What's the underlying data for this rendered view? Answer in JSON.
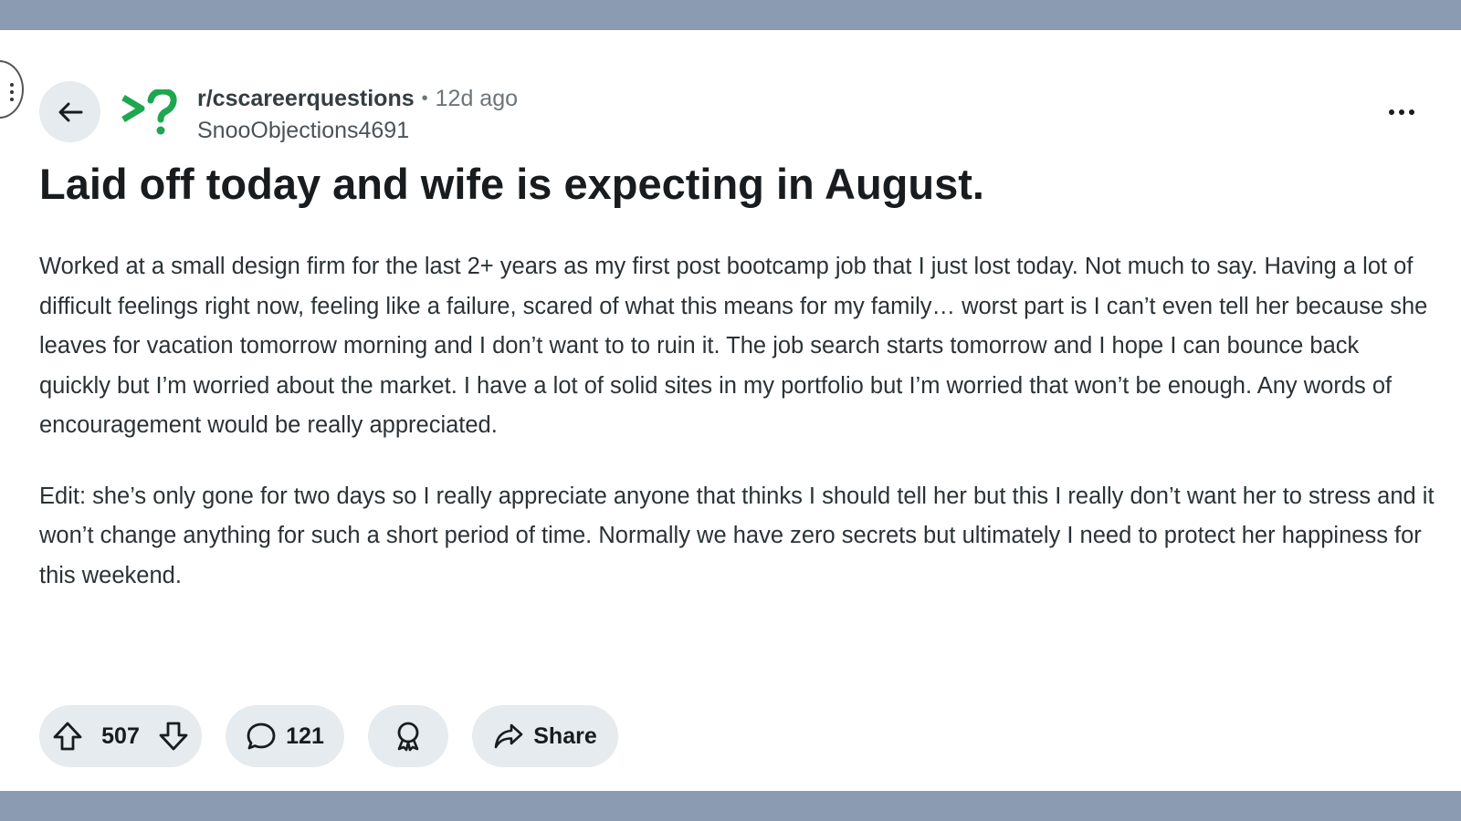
{
  "post": {
    "subreddit": "r/cscareerquestions",
    "separator": "•",
    "age": "12d ago",
    "author": "SnooObjections4691",
    "title": "Laid off today and wife is expecting in August.",
    "paragraphs": [
      "Worked at a small design firm for the last 2+ years as my first post bootcamp job that I just lost today. Not much to say. Having a lot of difficult feelings right now, feeling like a failure, scared of what this means for my family… worst part is I can’t even tell her because she leaves for vacation tomorrow morning and I don’t want to to ruin it. The job search starts tomorrow and I hope I can bounce back quickly but I’m worried about the market. I have a lot of solid sites in my portfolio but I’m worried that won’t be enough. Any words of encouragement would be really appreciated.",
      "Edit: she’s only gone for two days so I really appreciate anyone that thinks I should tell her but this I really don’t want her to stress and it won’t change anything for such a short period of time. Normally we have zero secrets but ultimately I need to protect her happiness for this weekend."
    ]
  },
  "actions": {
    "votes": "507",
    "comments": "121",
    "share_label": "Share"
  },
  "icons": {
    "back": "arrow-left-icon",
    "subreddit_avatar": "cscareerquestions-logo",
    "more": "more-horizontal-icon",
    "upvote": "arrow-up-icon",
    "downvote": "arrow-down-icon",
    "comment": "speech-bubble-icon",
    "award": "award-ribbon-icon",
    "share": "share-arrow-icon"
  },
  "colors": {
    "frame_background": "#8a9bb2",
    "card_background": "#ffffff",
    "pill_background": "#e5ebee",
    "subreddit_logo": "#1fa650",
    "title_text": "#181c1f"
  }
}
